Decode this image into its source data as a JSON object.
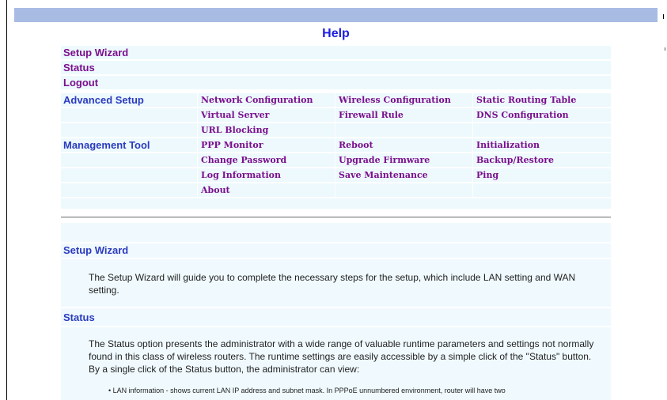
{
  "page": {
    "title": "Help"
  },
  "nav": {
    "setup_wizard": "Setup Wizard",
    "status": "Status",
    "logout": "Logout",
    "advanced_setup": {
      "label": "Advanced Setup",
      "links": [
        "Network Configuration",
        "Wireless Configuration",
        "Static Routing Table",
        "Virtual Server",
        "Firewall Rule",
        "DNS Configuration",
        "URL Blocking"
      ]
    },
    "management_tool": {
      "label": "Management Tool",
      "links": [
        "PPP Monitor",
        "Reboot",
        "Initialization",
        "Change Password",
        "Upgrade Firmware",
        "Backup/Restore",
        "Log Information",
        "Save Maintenance",
        "Ping",
        "About"
      ]
    }
  },
  "sections": [
    {
      "heading": "Setup Wizard",
      "text": "The Setup Wizard will guide you to complete the necessary steps for the setup, which include LAN setting and WAN setting."
    },
    {
      "heading": "Status",
      "text": "The Status option presents the administrator with a wide range of valuable runtime parameters and settings not normally found in this class of wireless routers. The runtime settings are easily accessible by a simple click of the \"Status\" button. By a single click of the Status button, the administrator can view:",
      "bullet": "LAN information - shows current LAN IP address and subnet mask. In PPPoE unnumbered environment, router will have two"
    }
  ],
  "colors": {
    "header_bar": "#a7bbe3",
    "row_bg": "#edf9fd",
    "link_purple": "#7a0f8c",
    "heading_blue": "#2b3bbf",
    "title_blue": "#1c1ee0"
  }
}
